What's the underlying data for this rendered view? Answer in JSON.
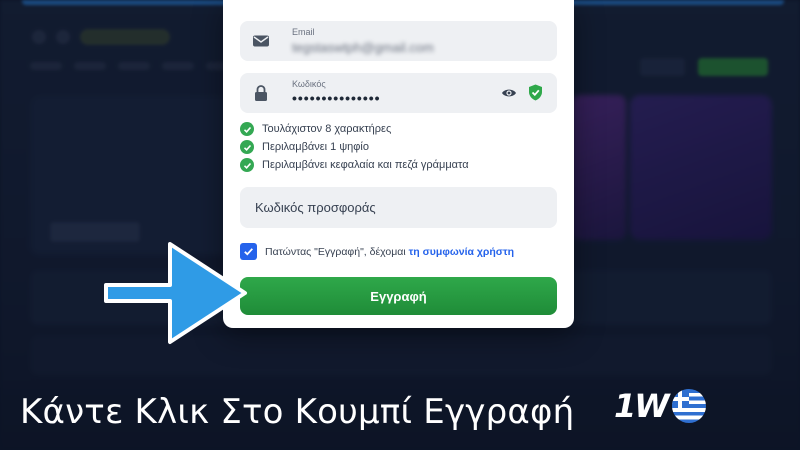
{
  "form": {
    "email": {
      "label": "Email",
      "value": "tegstaswtph@gmail.com"
    },
    "password": {
      "label": "Κωδικός",
      "value": "•••••••••••••••"
    },
    "rules": [
      "Τουλάχιστον 8 χαρακτήρες",
      "Περιλαμβάνει 1 ψηφίο",
      "Περιλαμβάνει κεφαλαία και πεζά γράμματα"
    ],
    "promo_placeholder": "Κωδικός προσφοράς",
    "agreement": {
      "text": "Πατώντας \"Εγγραφή\", δέχομαι ",
      "link": "τη συμφωνία χρήστη",
      "checked": true
    },
    "register_label": "Εγγραφή"
  },
  "caption": "Κάντε Κλικ Στο Κουμπί Εγγραφή",
  "brand": {
    "logo_text": "1W"
  },
  "colors": {
    "accent_green": "#2fa84a",
    "link_blue": "#2563eb",
    "arrow_blue": "#2f9be6",
    "check_green": "#34a853"
  },
  "icons": [
    "mail-icon",
    "lock-icon",
    "eye-icon",
    "shield-check-icon",
    "check-circle-icon",
    "checkbox-checked-icon",
    "arrow-right-icon",
    "greek-flag-icon"
  ]
}
